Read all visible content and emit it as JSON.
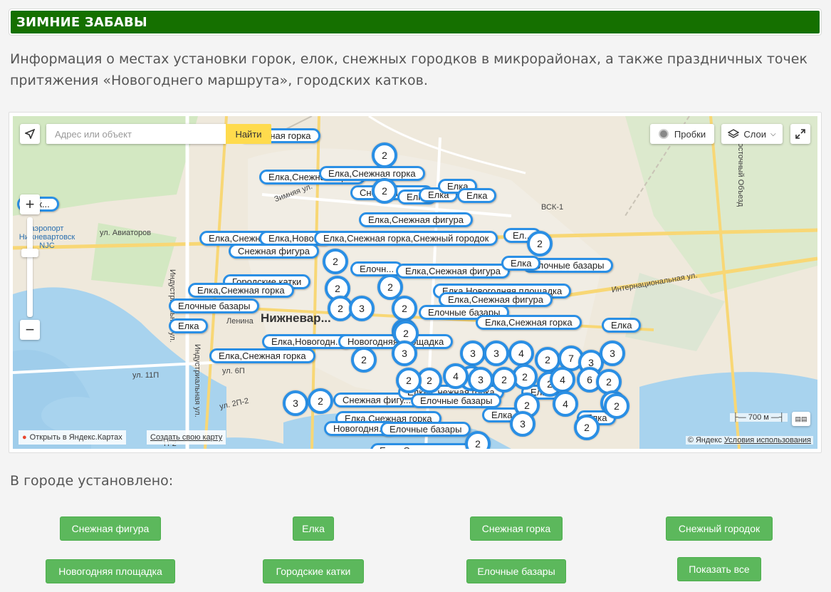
{
  "header": {
    "title": "ЗИМНИЕ ЗАБАВЫ"
  },
  "intro": "Информация о местах установки горок, елок, снежных городков в микрорайонах, а также праздничных точек притяжения «Новогоднего маршрута», городских катков.",
  "map": {
    "search_placeholder": "Адрес или объект",
    "search_button": "Найти",
    "traffic_button": "Пробки",
    "layers_button": "Слои",
    "open_in_yandex": "Открыть в Яндекс.Картах",
    "create_map": "Создать свою карту",
    "copyright": "© Яндекс",
    "terms": "Условия использования",
    "scale": "700 м",
    "places": {
      "city": "Нижневар...",
      "airport": "аэропорт Нижневартовск NJC",
      "aviators": "ул. Авиаторов",
      "industrial": "Индустриальная ул.",
      "industrial2": "Индустриальная ул.",
      "international": "Интернациональная ул.",
      "zimnyaya": "Зимняя ул.",
      "vostochny": "Восточный Объезд",
      "lenina": "Ленина",
      "u11p": "ул. 11П",
      "u6p": "ул. 6П",
      "u2p2": "ул. 2П-2",
      "p2": "П-2",
      "vsk": "ВСК-1"
    },
    "labels": [
      {
        "text": "Снежная горка"
      },
      {
        "text": "Елка,Снежная горка"
      },
      {
        "text": "Елка,Снежная горка"
      },
      {
        "text": "Снежная горка"
      },
      {
        "text": "Елка"
      },
      {
        "text": "Елка"
      },
      {
        "text": "Елка"
      },
      {
        "text": "Елка"
      },
      {
        "text": "Елка,Снежная фигура"
      },
      {
        "text": "Елка,Снежн..."
      },
      {
        "text": "Елка,Ново..."
      },
      {
        "text": "Елка,Снежная горка,Снежный городок"
      },
      {
        "text": "Снежная фигура"
      },
      {
        "text": "Елочн..."
      },
      {
        "text": "Елка,Снежная фигура"
      },
      {
        "text": "Елочные базары"
      },
      {
        "text": "Елка"
      },
      {
        "text": "Городские катки"
      },
      {
        "text": "Елка,Снежная горка"
      },
      {
        "text": "Елка,Новогодняя площадка"
      },
      {
        "text": "Елка,Снежная фигура"
      },
      {
        "text": "Елочные базары"
      },
      {
        "text": "Елочные базары"
      },
      {
        "text": "Елка"
      },
      {
        "text": "Елка,Снежная горка"
      },
      {
        "text": "Елка"
      },
      {
        "text": "Елка,Новогодн..."
      },
      {
        "text": "Новогодняя площадка"
      },
      {
        "text": "Елка,Снежная горка"
      },
      {
        "text": "Снежная фигу..."
      },
      {
        "text": "Елка,Снежная горка"
      },
      {
        "text": "Елочные базары"
      },
      {
        "text": "Елка..."
      },
      {
        "text": "Елка"
      },
      {
        "text": "Елка"
      },
      {
        "text": "Елка,Снежная горка"
      },
      {
        "text": "Новогодня..."
      },
      {
        "text": "Елочные базары"
      },
      {
        "text": "Елка,Снежная горка"
      },
      {
        "text": "Ел..."
      },
      {
        "text": "Елк..."
      }
    ],
    "clusters": [
      {
        "n": "2"
      },
      {
        "n": "2"
      },
      {
        "n": "2"
      },
      {
        "n": "2"
      },
      {
        "n": "2"
      },
      {
        "n": "3"
      },
      {
        "n": "2"
      },
      {
        "n": "2"
      },
      {
        "n": "2"
      },
      {
        "n": "2"
      },
      {
        "n": "3"
      },
      {
        "n": "2"
      },
      {
        "n": "4"
      },
      {
        "n": "3"
      },
      {
        "n": "3"
      },
      {
        "n": "3"
      },
      {
        "n": "4"
      },
      {
        "n": "2"
      },
      {
        "n": "7"
      },
      {
        "n": "3"
      },
      {
        "n": "3"
      },
      {
        "n": "2"
      },
      {
        "n": "2"
      },
      {
        "n": "2"
      },
      {
        "n": "3"
      },
      {
        "n": "2"
      },
      {
        "n": "2"
      },
      {
        "n": "2"
      },
      {
        "n": "4"
      },
      {
        "n": "6"
      },
      {
        "n": "2"
      },
      {
        "n": "3"
      },
      {
        "n": "2"
      },
      {
        "n": "2"
      },
      {
        "n": "4"
      },
      {
        "n": "2"
      },
      {
        "n": "2"
      },
      {
        "n": "3"
      },
      {
        "n": "2"
      },
      {
        "n": "2"
      }
    ]
  },
  "summary_heading": "В городе установлено:",
  "filters": [
    {
      "label": "Снежная фигура"
    },
    {
      "label": "Елка"
    },
    {
      "label": "Снежная горка"
    },
    {
      "label": "Снежный городок"
    },
    {
      "label": "Новогодняя площадка"
    },
    {
      "label": "Городские катки"
    },
    {
      "label": "Елочные базары"
    },
    {
      "label": "Показать все"
    }
  ],
  "colors": {
    "header_bg": "#157000",
    "marker": "#2a8fe5",
    "filter_button": "#5cb85c",
    "search_button": "#ffdb4d"
  }
}
